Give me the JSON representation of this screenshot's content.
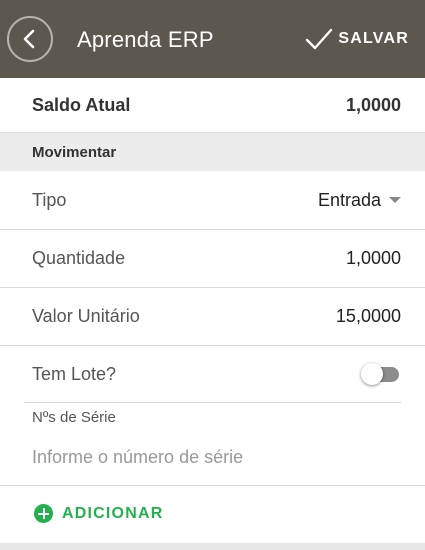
{
  "header": {
    "title": "Aprenda ERP",
    "save_label": "SALVAR",
    "background_color": "#5c574f",
    "back_icon": "chevron-left-icon",
    "save_icon": "check-icon"
  },
  "saldo": {
    "label": "Saldo Atual",
    "value": "1,0000"
  },
  "section": {
    "title": "Movimentar"
  },
  "fields": {
    "tipo": {
      "label": "Tipo",
      "value": "Entrada"
    },
    "quantidade": {
      "label": "Quantidade",
      "value": "1,0000"
    },
    "valor_unitario": {
      "label": "Valor Unitário",
      "value": "15,0000"
    },
    "tem_lote": {
      "label": "Tem Lote?",
      "checked": false
    }
  },
  "serie": {
    "label": "Nºs de Série",
    "placeholder": "Informe o número de série",
    "value": ""
  },
  "add": {
    "label": "ADICIONAR",
    "color": "#22b24c"
  }
}
